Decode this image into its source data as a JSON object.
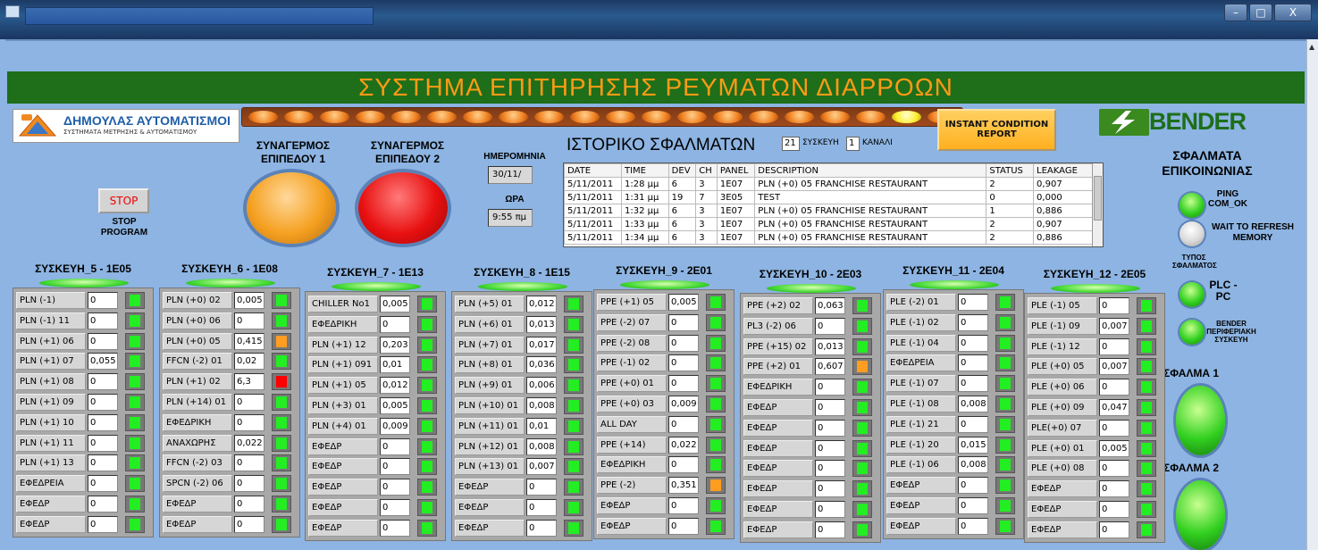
{
  "window": {
    "title": "",
    "buttons": [
      "–",
      "□",
      "X"
    ]
  },
  "header": {
    "title": "ΣΥΣΤΗΜΑ ΕΠΙΤΗΡΗΣΗΣ ΡΕΥΜΑΤΩΝ ΔΙΑΡΡΟΩΝ"
  },
  "logo_left": {
    "name": "ΔΗΜΟΥΛΑΣ ΑΥΤΟΜΑΤΙΣΜΟΙ",
    "subtitle": "ΣΥΣΤΗΜΑΤΑ ΜΕΤΡΗΣΗΣ & ΑΥΤΟΜΑΤΙΣΜΟΥ"
  },
  "logo_right": {
    "name": "BENDER"
  },
  "leds": {
    "count": 20,
    "active_index": 18
  },
  "alarms": {
    "level1": "ΣΥΝΑΓΕΡΜΟΣ ΕΠΙΠΕΔΟΥ 1",
    "level2": "ΣΥΝΑΓΕΡΜΟΣ ΕΠΙΠΕΔΟΥ 2"
  },
  "stop": {
    "button": "STOP",
    "label": "STOP PROGRAM"
  },
  "datetime": {
    "date_label": "ΗΜΕΡΟΜΗΝΙΑ",
    "date_value": "30/11/",
    "time_label": "ΩΡΑ",
    "time_value": "9:55 πμ"
  },
  "history": {
    "title": "ΙΣΤΟΡΙΚΟ ΣΦΑΛΜΑΤΩΝ",
    "device_value": "21",
    "device_label": "ΣΥΣΚΕΥΗ",
    "channel_value": "1",
    "channel_label": "ΚΑΝΑΛΙ",
    "columns": [
      "DATE",
      "TIME",
      "DEV",
      "CH",
      "PANEL",
      "DESCRIPTION",
      "STATUS",
      "LEAKAGE"
    ],
    "rows": [
      [
        "5/11/2011",
        "1:28 μμ",
        "6",
        "3",
        "1E07",
        "PLN (+0) 05 FRANCHISE RESTAURANT",
        "2",
        "0,907"
      ],
      [
        "5/11/2011",
        "1:31 μμ",
        "19",
        "7",
        "3E05",
        "TEST",
        "0",
        "0,000"
      ],
      [
        "5/11/2011",
        "1:32 μμ",
        "6",
        "3",
        "1E07",
        "PLN (+0) 05 FRANCHISE RESTAURANT",
        "1",
        "0,886"
      ],
      [
        "5/11/2011",
        "1:33 μμ",
        "6",
        "3",
        "1E07",
        "PLN (+0) 05 FRANCHISE RESTAURANT",
        "2",
        "0,907"
      ],
      [
        "5/11/2011",
        "1:34 μμ",
        "6",
        "3",
        "1E07",
        "PLN (+0) 05 FRANCHISE RESTAURANT",
        "2",
        "0,886"
      ]
    ]
  },
  "instant": {
    "button": "INSTANT CONDITION REPORT"
  },
  "comm": {
    "title": "ΣΦΑΛΜΑΤΑ ΕΠΙΚΟΙΝΩΝΙΑΣ",
    "ping": "PING COM_OK",
    "wait": "WAIT TO REFRESH MEMORY",
    "fault_type": "ΤΥΠΟΣ ΣΦΑΛΜΑΤΟΣ",
    "plc": "PLC - PC",
    "bender": "BENDER ΠΕΡΙΦΕΡΙΑΚΗ ΣΥΣΚΕΥΗ",
    "error1": "ΣΦΑΛΜΑ 1",
    "error2": "ΣΦΑΛΜΑ 2"
  },
  "devices": [
    {
      "title": "ΣΥΣΚΕΥΗ_5 - 1E05",
      "rows": [
        {
          "name": "PLN (-1)",
          "value": "0",
          "status": "green"
        },
        {
          "name": "PLN (-1) 11",
          "value": "0",
          "status": "green"
        },
        {
          "name": "PLN (+1) 06",
          "value": "0",
          "status": "green"
        },
        {
          "name": "PLN (+1) 07",
          "value": "0,055",
          "status": "green"
        },
        {
          "name": "PLN (+1) 08",
          "value": "0",
          "status": "green"
        },
        {
          "name": "PLN (+1) 09",
          "value": "0",
          "status": "green"
        },
        {
          "name": "PLN (+1) 10",
          "value": "0",
          "status": "green"
        },
        {
          "name": "PLN (+1) 11",
          "value": "0",
          "status": "green"
        },
        {
          "name": "PLN (+1) 13",
          "value": "0",
          "status": "green"
        },
        {
          "name": "ΕΦΕΔΡΕΙΑ",
          "value": "0",
          "status": "green"
        },
        {
          "name": "ΕΦΕΔΡ",
          "value": "0",
          "status": "green"
        },
        {
          "name": "ΕΦΕΔΡ",
          "value": "0",
          "status": "green"
        }
      ]
    },
    {
      "title": "ΣΥΣΚΕΥΗ_6 - 1E08",
      "rows": [
        {
          "name": "PLN (+0) 02",
          "value": "0,005",
          "status": "green"
        },
        {
          "name": "PLN (+0) 06",
          "value": "0",
          "status": "green"
        },
        {
          "name": "PLN (+0) 05",
          "value": "0,415",
          "status": "orange"
        },
        {
          "name": "FFCN (-2) 01",
          "value": "0,02",
          "status": "green"
        },
        {
          "name": "PLN (+1) 02",
          "value": "6,3",
          "status": "red"
        },
        {
          "name": "PLN (+14) 01",
          "value": "0",
          "status": "green"
        },
        {
          "name": "ΕΦΕΔΡΙΚΗ",
          "value": "0",
          "status": "green"
        },
        {
          "name": "ΑΝΑΧΩΡΗΣ",
          "value": "0,022",
          "status": "green"
        },
        {
          "name": "FFCN (-2) 03",
          "value": "0",
          "status": "green"
        },
        {
          "name": "SPCN (-2) 06",
          "value": "0",
          "status": "green"
        },
        {
          "name": "ΕΦΕΔΡ",
          "value": "0",
          "status": "green"
        },
        {
          "name": "ΕΦΕΔΡ",
          "value": "0",
          "status": "green"
        }
      ]
    },
    {
      "title": "ΣΥΣΚΕΥΗ_7 - 1E13",
      "rows": [
        {
          "name": "CHILLER No1",
          "value": "0,005",
          "status": "green"
        },
        {
          "name": "ΕΦΕΔΡΙΚΗ",
          "value": "0",
          "status": "green"
        },
        {
          "name": "PLN (+1) 12",
          "value": "0,203",
          "status": "green"
        },
        {
          "name": "PLN (+1) 091",
          "value": "0,01",
          "status": "green"
        },
        {
          "name": "PLN (+1) 05",
          "value": "0,012",
          "status": "green"
        },
        {
          "name": "PLN (+3) 01",
          "value": "0,005",
          "status": "green"
        },
        {
          "name": "PLN (+4) 01",
          "value": "0,009",
          "status": "green"
        },
        {
          "name": "ΕΦΕΔΡ",
          "value": "0",
          "status": "green"
        },
        {
          "name": "ΕΦΕΔΡ",
          "value": "0",
          "status": "green"
        },
        {
          "name": "ΕΦΕΔΡ",
          "value": "0",
          "status": "green"
        },
        {
          "name": "ΕΦΕΔΡ",
          "value": "0",
          "status": "green"
        },
        {
          "name": "ΕΦΕΔΡ",
          "value": "0",
          "status": "green"
        }
      ]
    },
    {
      "title": "ΣΥΣΚΕΥΗ_8 - 1E15",
      "rows": [
        {
          "name": "PLN (+5) 01",
          "value": "0,012",
          "status": "green"
        },
        {
          "name": "PLN (+6) 01",
          "value": "0,013",
          "status": "green"
        },
        {
          "name": "PLN (+7) 01",
          "value": "0,017",
          "status": "green"
        },
        {
          "name": "PLN (+8) 01",
          "value": "0,036",
          "status": "green"
        },
        {
          "name": "PLN (+9) 01",
          "value": "0,006",
          "status": "green"
        },
        {
          "name": "PLN (+10) 01",
          "value": "0,008",
          "status": "green"
        },
        {
          "name": "PLN (+11) 01",
          "value": "0,01",
          "status": "green"
        },
        {
          "name": "PLN (+12) 01",
          "value": "0,008",
          "status": "green"
        },
        {
          "name": "PLN (+13) 01",
          "value": "0,007",
          "status": "green"
        },
        {
          "name": "ΕΦΕΔΡ",
          "value": "0",
          "status": "green"
        },
        {
          "name": "ΕΦΕΔΡ",
          "value": "0",
          "status": "green"
        },
        {
          "name": "ΕΦΕΔΡ",
          "value": "0",
          "status": "green"
        }
      ]
    },
    {
      "title": "ΣΥΣΚΕΥΗ_9 - 2E01",
      "rows": [
        {
          "name": "PPE (+1) 05",
          "value": "0,005",
          "status": "green"
        },
        {
          "name": "PPE (-2) 07",
          "value": "0",
          "status": "green"
        },
        {
          "name": "PPE (-2) 08",
          "value": "0",
          "status": "green"
        },
        {
          "name": "PPE (-1) 02",
          "value": "0",
          "status": "green"
        },
        {
          "name": "PPE (+0) 01",
          "value": "0",
          "status": "green"
        },
        {
          "name": "PPE (+0) 03",
          "value": "0,009",
          "status": "green"
        },
        {
          "name": "ALL DAY",
          "value": "0",
          "status": "green"
        },
        {
          "name": "PPE (+14)",
          "value": "0,022",
          "status": "green"
        },
        {
          "name": "ΕΦΕΔΡΙΚΗ",
          "value": "0",
          "status": "green"
        },
        {
          "name": "PPE (-2)",
          "value": "0,351",
          "status": "orange"
        },
        {
          "name": "ΕΦΕΔΡ",
          "value": "0",
          "status": "green"
        },
        {
          "name": "ΕΦΕΔΡ",
          "value": "0",
          "status": "green"
        }
      ]
    },
    {
      "title": "ΣΥΣΚΕΥΗ_10 - 2E03",
      "rows": [
        {
          "name": "PPE (+2) 02",
          "value": "0,063",
          "status": "green"
        },
        {
          "name": "PL3 (-2) 06",
          "value": "0",
          "status": "green"
        },
        {
          "name": "PPE (+15) 02",
          "value": "0,013",
          "status": "green"
        },
        {
          "name": "PPE (+2) 01",
          "value": "0,607",
          "status": "orange"
        },
        {
          "name": "ΕΦΕΔΡΙΚΗ",
          "value": "0",
          "status": "green"
        },
        {
          "name": "ΕΦΕΔΡ",
          "value": "0",
          "status": "green"
        },
        {
          "name": "ΕΦΕΔΡ",
          "value": "0",
          "status": "green"
        },
        {
          "name": "ΕΦΕΔΡ",
          "value": "0",
          "status": "green"
        },
        {
          "name": "ΕΦΕΔΡ",
          "value": "0",
          "status": "green"
        },
        {
          "name": "ΕΦΕΔΡ",
          "value": "0",
          "status": "green"
        },
        {
          "name": "ΕΦΕΔΡ",
          "value": "0",
          "status": "green"
        },
        {
          "name": "ΕΦΕΔΡ",
          "value": "0",
          "status": "green"
        }
      ]
    },
    {
      "title": "ΣΥΣΚΕΥΗ_11 - 2E04",
      "rows": [
        {
          "name": "PLE (-2) 01",
          "value": "0",
          "status": "green"
        },
        {
          "name": "PLE (-1) 02",
          "value": "0",
          "status": "green"
        },
        {
          "name": "PLE (-1) 04",
          "value": "0",
          "status": "green"
        },
        {
          "name": "ΕΦΕΔΡΕΙΑ",
          "value": "0",
          "status": "green"
        },
        {
          "name": "PLE (-1) 07",
          "value": "0",
          "status": "green"
        },
        {
          "name": "PLE (-1) 08",
          "value": "0,008",
          "status": "green"
        },
        {
          "name": "PLE (-1) 21",
          "value": "0",
          "status": "green"
        },
        {
          "name": "PLE (-1) 20",
          "value": "0,015",
          "status": "green"
        },
        {
          "name": "PLE (-1) 06",
          "value": "0,008",
          "status": "green"
        },
        {
          "name": "ΕΦΕΔΡ",
          "value": "0",
          "status": "green"
        },
        {
          "name": "ΕΦΕΔΡ",
          "value": "0",
          "status": "green"
        },
        {
          "name": "ΕΦΕΔΡ",
          "value": "0",
          "status": "green"
        }
      ]
    },
    {
      "title": "ΣΥΣΚΕΥΗ_12 - 2E05",
      "rows": [
        {
          "name": "PLE (-1) 05",
          "value": "0",
          "status": "green"
        },
        {
          "name": "PLE (-1) 09",
          "value": "0,007",
          "status": "green"
        },
        {
          "name": "PLE (-1) 12",
          "value": "0",
          "status": "green"
        },
        {
          "name": "PLE (+0) 05",
          "value": "0,007",
          "status": "green"
        },
        {
          "name": "PLE (+0) 06",
          "value": "0",
          "status": "green"
        },
        {
          "name": "PLE (+0) 09",
          "value": "0,047",
          "status": "green"
        },
        {
          "name": "PLE(+0) 07",
          "value": "0",
          "status": "green"
        },
        {
          "name": "PLE (+0) 01",
          "value": "0,005",
          "status": "green"
        },
        {
          "name": "PLE (+0) 08",
          "value": "0",
          "status": "green"
        },
        {
          "name": "ΕΦΕΔΡ",
          "value": "0",
          "status": "green"
        },
        {
          "name": "ΕΦΕΔΡ",
          "value": "0",
          "status": "green"
        },
        {
          "name": "ΕΦΕΔΡ",
          "value": "0",
          "status": "green"
        }
      ]
    }
  ]
}
